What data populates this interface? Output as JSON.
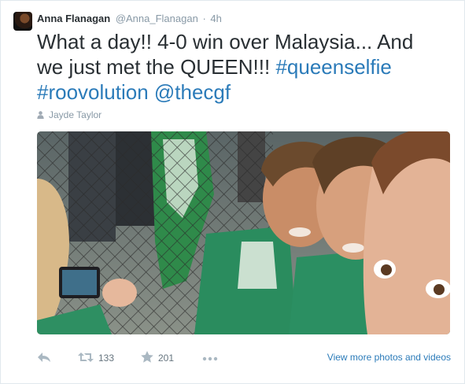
{
  "tweet": {
    "author": {
      "full_name": "Anna Flanagan",
      "username": "@Anna_Flanagan"
    },
    "separator": "·",
    "time": "4h",
    "text": {
      "line1": "What a day!! 4-0 win over Malaysia... And",
      "line2_plain": "we just met the QUEEN!!! ",
      "hashtag1": "#queenselfie",
      "hashtag2": "#roovolution",
      "mention": "@thecgf"
    },
    "tagged_person": "Jayde Taylor",
    "actions": {
      "retweet_count": "133",
      "favorite_count": "201",
      "view_more": "View more photos and videos"
    },
    "icons": {
      "avatar": "avatar-photo",
      "tagged": "person-icon",
      "reply": "reply-icon",
      "retweet": "retweet-icon",
      "favorite": "star-icon",
      "more": "more-icon"
    },
    "colors": {
      "link": "#2b7bb9",
      "meta": "#8899a6",
      "text": "#292f33"
    }
  }
}
